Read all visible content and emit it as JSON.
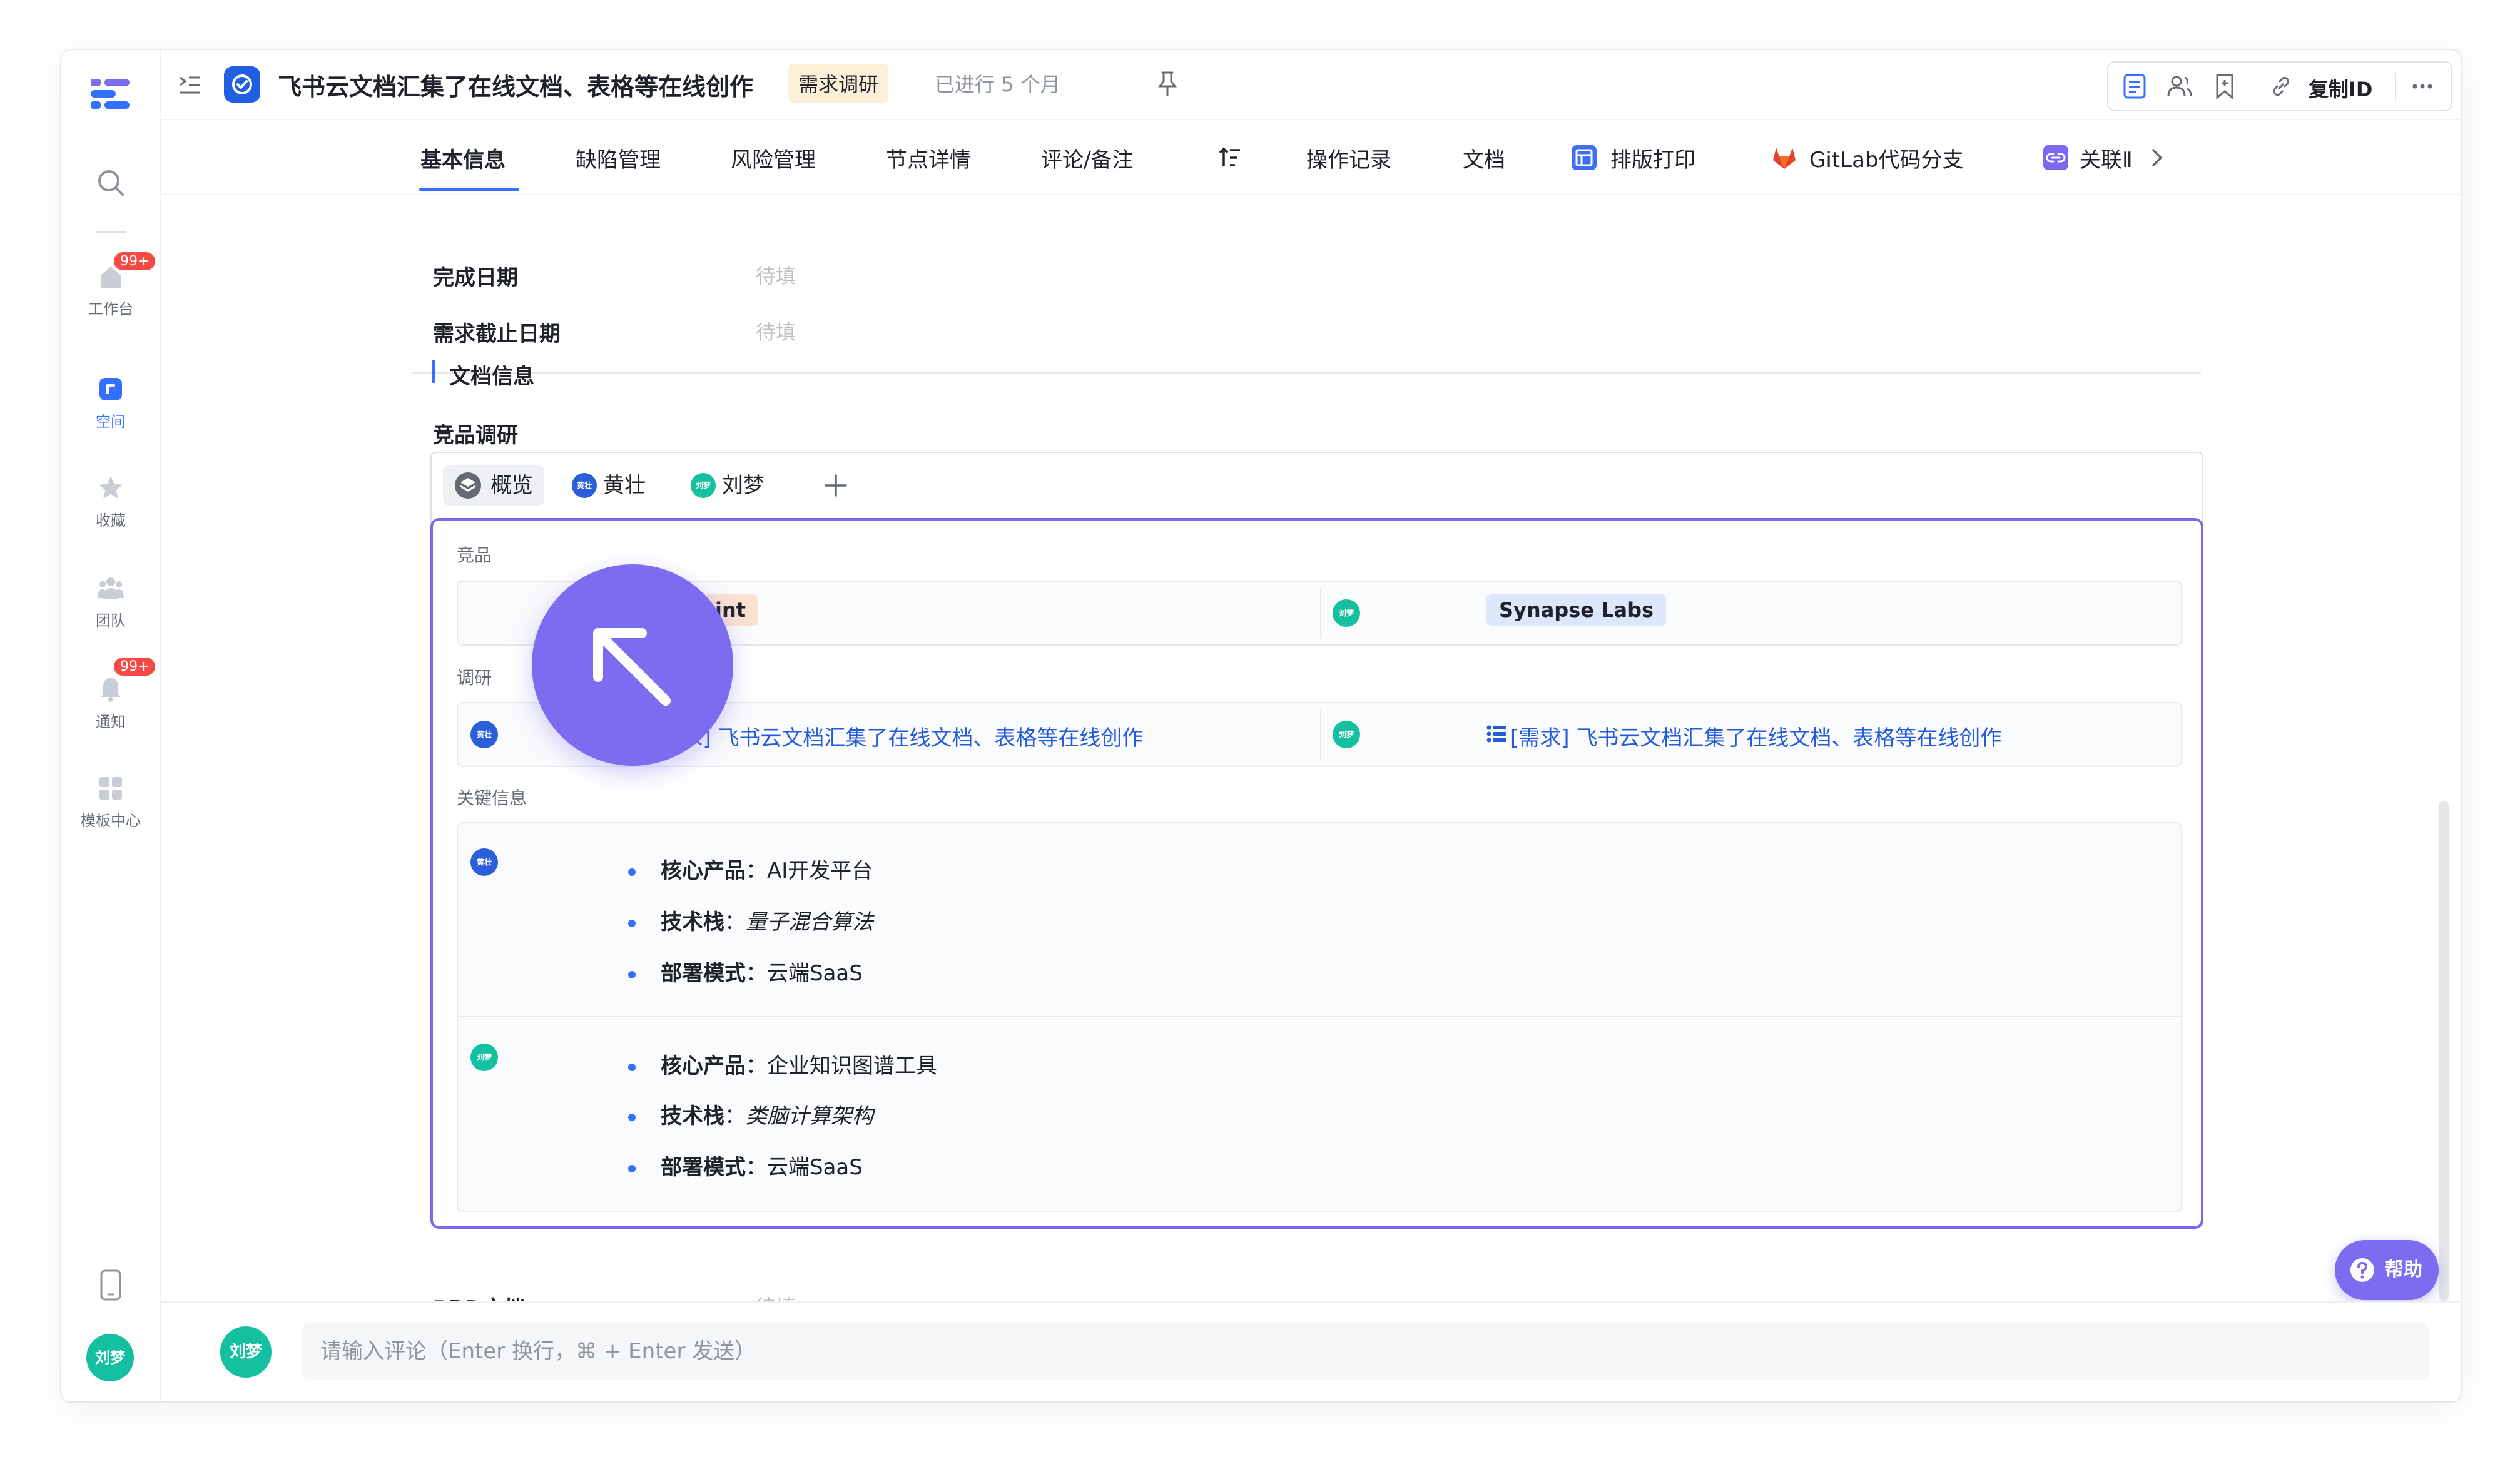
{
  "sidebar": {
    "items": [
      {
        "label": "",
        "icon": "search-icon"
      },
      {
        "label": "工作台",
        "icon": "home-icon",
        "badge": "99+"
      },
      {
        "label": "空间",
        "icon": "space-icon",
        "active": true
      },
      {
        "label": "收藏",
        "icon": "star-icon"
      },
      {
        "label": "团队",
        "icon": "team-icon"
      },
      {
        "label": "通知",
        "icon": "bell-icon",
        "badge": "99+"
      },
      {
        "label": "模板中心",
        "icon": "template-icon"
      }
    ],
    "user_avatar": "刘梦"
  },
  "header": {
    "title": "飞书云文档汇集了在线文档、表格等在线创作",
    "tag": "需求调研",
    "status": "已进行 5 个月",
    "copy_id": "复制ID"
  },
  "tabs": [
    "基本信息",
    "缺陷管理",
    "风险管理",
    "节点详情",
    "评论/备注",
    "操作记录",
    "文档",
    "排版打印",
    "GitLab代码分支",
    "关联Ⅱ"
  ],
  "fields": {
    "complete_date": {
      "label": "完成日期",
      "value": "待填"
    },
    "deadline": {
      "label": "需求截止日期",
      "value": "待填"
    },
    "prd": {
      "label": "PRD文档",
      "value": "待填"
    }
  },
  "doc_info": {
    "section_title": "文档信息",
    "table_title": "竞品调研",
    "card_tabs": [
      "概览",
      "黄壮",
      "刘梦"
    ],
    "competitor_label": "竞品",
    "competitors": [
      {
        "user": "黄壮",
        "name": "xus Point"
      },
      {
        "user": "刘梦",
        "name": "Synapse Labs"
      }
    ],
    "research_label": "调研",
    "research_links": [
      {
        "user": "黄壮",
        "text": "[需求] 飞书云文档汇集了在线文档、表格等在线创作"
      },
      {
        "user": "刘梦",
        "text": "[需求] 飞书云文档汇集了在线文档、表格等在线创作"
      }
    ],
    "key_info_label": "关键信息",
    "key_info": [
      {
        "user": "黄壮",
        "items": [
          {
            "k": "核心产品",
            "v": "AI开发平台",
            "italic": false
          },
          {
            "k": "技术栈",
            "v": "量子混合算法",
            "italic": true
          },
          {
            "k": "部署模式",
            "v": "云端SaaS",
            "italic": false
          }
        ]
      },
      {
        "user": "刘梦",
        "items": [
          {
            "k": "核心产品",
            "v": "企业知识图谱工具",
            "italic": false
          },
          {
            "k": "技术栈",
            "v": "类脑计算架构",
            "italic": true
          },
          {
            "k": "部署模式",
            "v": "云端SaaS",
            "italic": false
          }
        ]
      }
    ]
  },
  "comment": {
    "avatar": "刘梦",
    "placeholder": "请输入评论（Enter 换行，⌘ + Enter 发送）"
  },
  "help_label": "帮助",
  "colors": {
    "accent": "#3370ff",
    "purple": "#7c6cf0",
    "teal": "#14c0a0",
    "blue_avatar": "#2b5fd9"
  }
}
